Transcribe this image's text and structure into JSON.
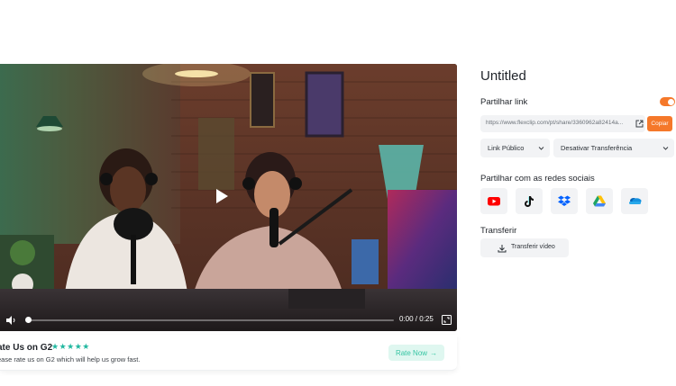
{
  "video": {
    "time": "0:00 / 0:25",
    "progress_fraction": 0.0
  },
  "rate_card": {
    "title": "ate Us on G2",
    "stars": "★★★★★",
    "subtitle": "ease rate us on G2 which will help us grow fast.",
    "button_label": "Rate Now",
    "button_arrow": "→"
  },
  "panel": {
    "title": "Untitled",
    "share_link_label": "Partilhar link",
    "toggle_on": true,
    "link_url": "https://www.flexclip.com/pt/share/3360962a82414a...",
    "copy_label": "Copiar",
    "access_select": "Link Público",
    "transfer_select": "Desativar Transferência",
    "social_label": "Partilhar com as redes sociais",
    "social_icons": [
      "youtube-icon",
      "tiktok-icon",
      "dropbox-icon",
      "google-drive-icon",
      "onedrive-icon"
    ],
    "transfer_label": "Transferir",
    "transfer_button": "Transferir vídeo"
  },
  "colors": {
    "accent": "#f5782a",
    "rate_green": "#35c5a3",
    "rate_green_bg": "#dff7f0"
  }
}
